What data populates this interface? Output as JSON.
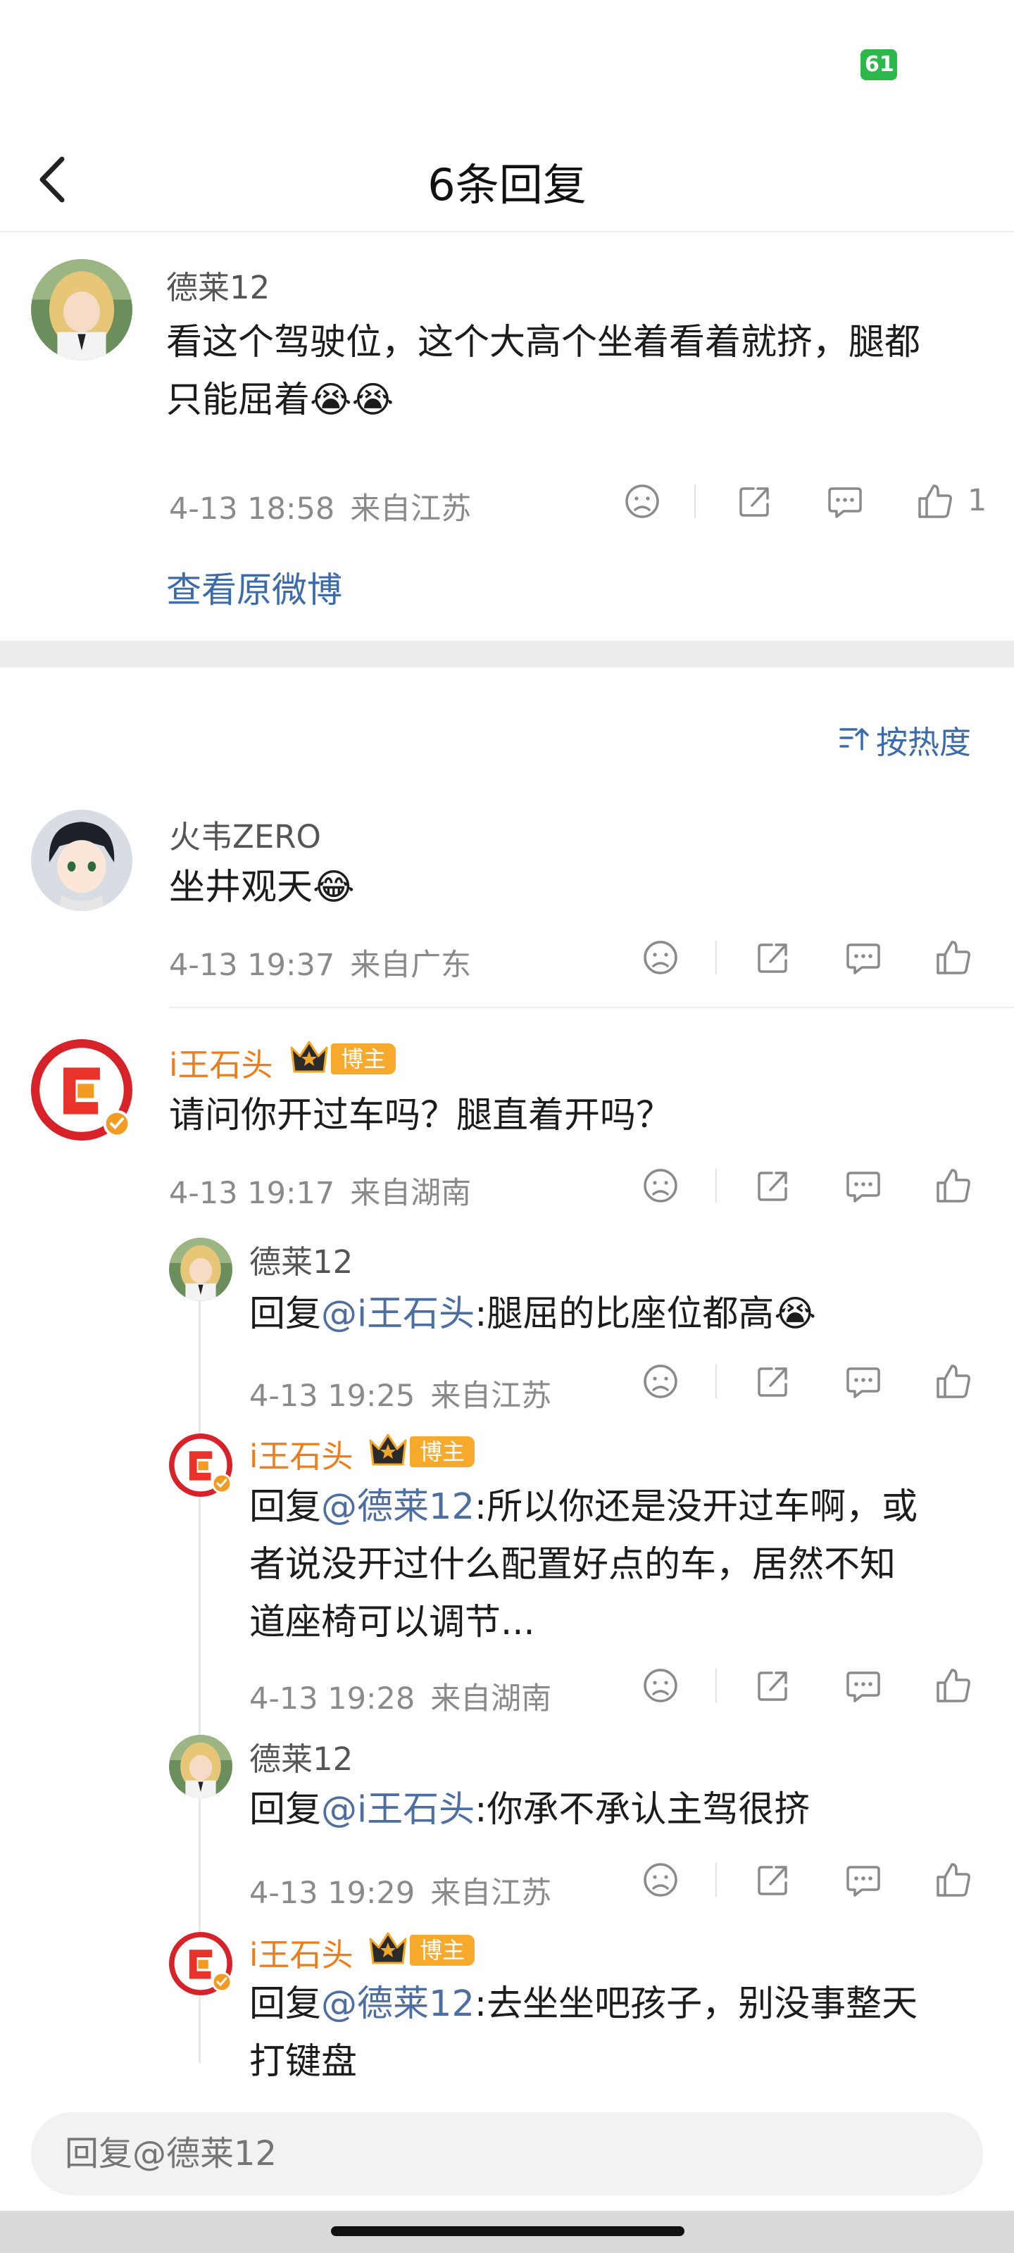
{
  "status": {
    "battery": "61"
  },
  "nav": {
    "title": "6条回复"
  },
  "original": {
    "user": "德莱12",
    "text_line1": "看这个驾驶位，这个大高个坐着看着就挤，腿都",
    "text_line2": "只能屈着",
    "emoji": "😭😭",
    "time": "4-13 18:58",
    "location": "来自江苏",
    "likes": "1",
    "view_original": "查看原微博"
  },
  "sort": {
    "label": "按热度"
  },
  "comments": [
    {
      "user": "火韦ZERO",
      "text": "坐井观天",
      "emoji": "😂",
      "time": "4-13 19:37",
      "location": "来自广东"
    },
    {
      "user": "i王石头",
      "badge": "博主",
      "text": "请问你开过车吗？腿直着开吗？",
      "time": "4-13 19:17",
      "location": "来自湖南",
      "replies": [
        {
          "user": "德莱12",
          "prefix": "回复",
          "mention": "@i王石头",
          "text": ":腿屈的比座位都高",
          "emoji": "😭",
          "time": "4-13 19:25",
          "location": "来自江苏"
        },
        {
          "user": "i王石头",
          "badge": "博主",
          "prefix": "回复",
          "mention": "@德莱12",
          "text_line1": ":所以你还是没开过车啊，或",
          "text_line2": "者说没开过什么配置好点的车，居然不知",
          "text_line3": "道座椅可以调节...",
          "time": "4-13 19:28",
          "location": "来自湖南"
        },
        {
          "user": "德莱12",
          "prefix": "回复",
          "mention": "@i王石头",
          "text": ":你承不承认主驾很挤",
          "time": "4-13 19:29",
          "location": "来自江苏"
        },
        {
          "user": "i王石头",
          "badge": "博主",
          "prefix": "回复",
          "mention": "@德莱12",
          "text_line1": ":去坐坐吧孩子，别没事整天",
          "text_line2": "打键盘"
        }
      ]
    }
  ],
  "reply_bar": {
    "placeholder": "回复@德莱12"
  },
  "colors": {
    "accent_blue": "#3c6bab",
    "username_orange": "#ef7c17",
    "badge_orange": "#f7a92c"
  },
  "icons": [
    "back-icon",
    "dislike-icon",
    "share-icon",
    "comment-icon",
    "like-icon",
    "sort-icon",
    "crown-icon",
    "verified-icon"
  ]
}
